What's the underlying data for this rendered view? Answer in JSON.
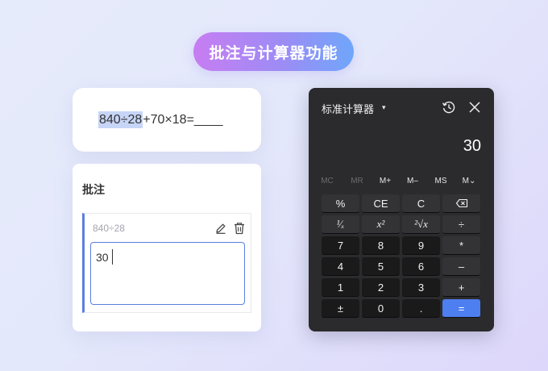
{
  "banner": {
    "title": "批注与计算器功能"
  },
  "expression_card": {
    "highlight": "840÷28",
    "rest": "+70×18=____"
  },
  "annotation": {
    "title": "批注",
    "reference": "840÷28",
    "input_value": "30",
    "icons": [
      "edit-icon",
      "delete-icon"
    ]
  },
  "calculator": {
    "title": "标准计算器",
    "mode_caret": "▾",
    "display": "30",
    "memory": [
      "MC",
      "MR",
      "M+",
      "M–",
      "MS",
      "M⌄"
    ],
    "keys": [
      [
        "%",
        "CE",
        "C",
        "⌫"
      ],
      [
        "¹⁄ₓ",
        "x²",
        "²√x",
        "÷"
      ],
      [
        "7",
        "8",
        "9",
        "*"
      ],
      [
        "4",
        "5",
        "6",
        "–"
      ],
      [
        "1",
        "2",
        "3",
        "+"
      ],
      [
        "±",
        "0",
        ".",
        "="
      ]
    ],
    "colors": {
      "body": "#2b2b2d",
      "key": "#1a1a1b",
      "equals": "#4e7ff0"
    }
  }
}
